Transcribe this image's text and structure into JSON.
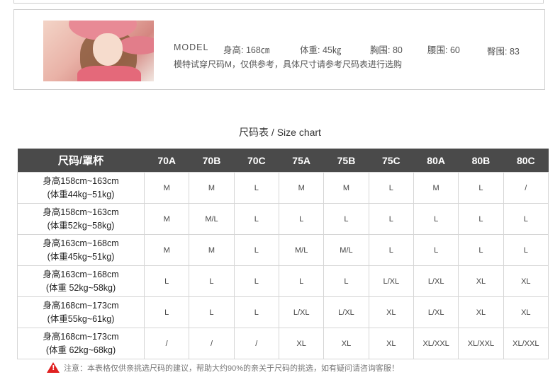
{
  "model": {
    "label": "MODEL",
    "height": "身高: 168㎝",
    "weight": "体重: 45㎏",
    "bust": "胸围: 80",
    "waist": "腰围: 60",
    "hip": "臀围: 83",
    "note": "模特试穿尺码M，仅供参考，具体尺寸请参考尺码表进行选购"
  },
  "chart": {
    "title": "尺码表 / Size chart",
    "header_first": "尺码/罩杯",
    "columns": [
      "70A",
      "70B",
      "70C",
      "75A",
      "75B",
      "75C",
      "80A",
      "80B",
      "80C"
    ],
    "rows": [
      {
        "line1": "身高158cm~163cm",
        "line2": "(体重44kg~51kg)",
        "cells": [
          "M",
          "M",
          "L",
          "M",
          "M",
          "L",
          "M",
          "L",
          "/"
        ]
      },
      {
        "line1": "身高158cm~163cm",
        "line2": "(体重52kg~58kg)",
        "cells": [
          "M",
          "M/L",
          "L",
          "L",
          "L",
          "L",
          "L",
          "L",
          "L"
        ]
      },
      {
        "line1": "身高163cm~168cm",
        "line2": "(体重45kg~51kg)",
        "cells": [
          "M",
          "M",
          "L",
          "M/L",
          "M/L",
          "L",
          "L",
          "L",
          "L"
        ]
      },
      {
        "line1": "身高163cm~168cm",
        "line2": "(体重 52kg~58kg)",
        "cells": [
          "L",
          "L",
          "L",
          "L",
          "L",
          "L/XL",
          "L/XL",
          "XL",
          "XL"
        ]
      },
      {
        "line1": "身高168cm~173cm",
        "line2": "(体重55kg~61kg)",
        "cells": [
          "L",
          "L",
          "L",
          "L/XL",
          "L/XL",
          "XL",
          "L/XL",
          "XL",
          "XL"
        ]
      },
      {
        "line1": "身高168cm~173cm",
        "line2": "(体重 62kg~68kg)",
        "cells": [
          "/",
          "/",
          "/",
          "XL",
          "XL",
          "XL",
          "XL/XXL",
          "XL/XXL",
          "XL/XXL"
        ]
      }
    ]
  },
  "warning": {
    "icon": "warning-triangle-icon",
    "text": "注意：本表格仅供亲挑选尺码的建议，帮助大约90%的亲关于尺码的挑选，如有疑问请咨询客服！",
    "color": "#e02020"
  }
}
